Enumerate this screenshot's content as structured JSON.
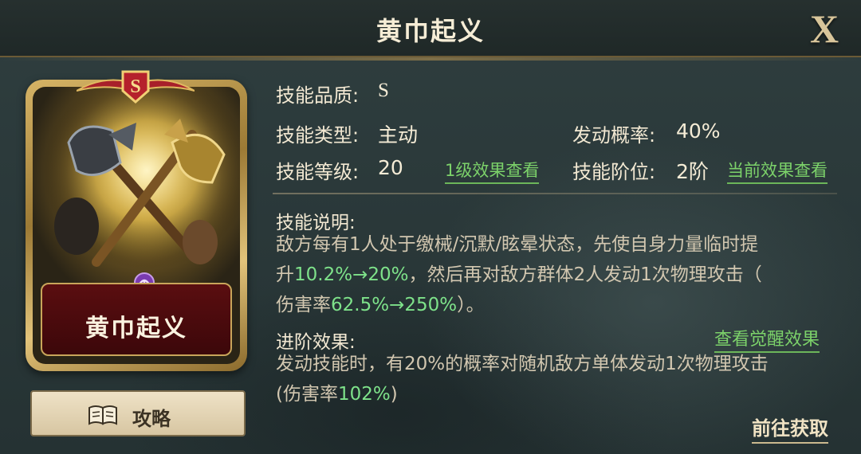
{
  "header": {
    "title": "黄巾起义",
    "close_label": "X"
  },
  "card": {
    "grade": "S",
    "name": "黄巾起义"
  },
  "guide": {
    "label": "攻略"
  },
  "info": {
    "quality_label": "技能品质:",
    "quality_value": "S",
    "type_label": "技能类型:",
    "type_value": "主动",
    "rate_label": "发动概率:",
    "rate_value": "40%",
    "level_label": "技能等级:",
    "level_value": "20",
    "level_link": "1级效果查看",
    "rank_label": "技能阶位:",
    "rank_value": "2阶",
    "rank_link": "当前效果查看"
  },
  "description": {
    "title": "技能说明:",
    "line1": "敌方每有1人处于缴械/沉默/眩晕状态，先使自身力量临时提",
    "line2_a": "升",
    "line2_hl": "10.2%→20%",
    "line2_b": "，然后再对敌方群体2人发动1次物理攻击（",
    "line3_a": "伤害率",
    "line3_hl": "62.5%→250%",
    "line3_b": "）。"
  },
  "advance": {
    "title": "进阶效果:",
    "awaken_link": "查看觉醒效果",
    "line1": "发动技能时，有20%的概率对随机敌方单体发动1次物理攻击",
    "line2_a": "(伤害率",
    "line2_hl": "102%",
    "line2_b": ")"
  },
  "goto_label": "前往获取",
  "colors": {
    "highlight": "#7ee28a",
    "link": "#7cd26a",
    "plate": "#5a0e10",
    "gold": "#c9a55a"
  }
}
